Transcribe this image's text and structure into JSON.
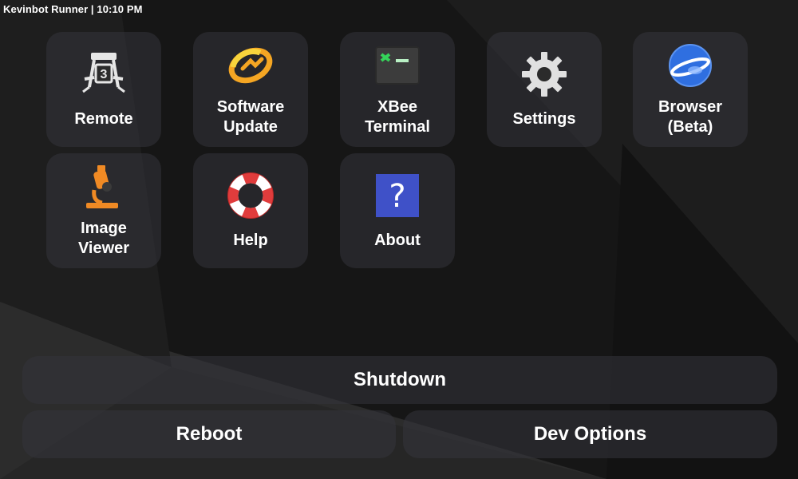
{
  "status_bar": {
    "text": "Kevinbot Runner | 10:10 PM"
  },
  "apps": [
    {
      "label": "Remote",
      "icon": "remote-icon"
    },
    {
      "label": "Software\nUpdate",
      "icon": "software-update-icon"
    },
    {
      "label": "XBee\nTerminal",
      "icon": "terminal-icon"
    },
    {
      "label": "Settings",
      "icon": "gear-icon"
    },
    {
      "label": "Browser\n(Beta)",
      "icon": "browser-icon"
    },
    {
      "label": "Image\nViewer",
      "icon": "microscope-icon"
    },
    {
      "label": "Help",
      "icon": "lifebuoy-icon"
    },
    {
      "label": "About",
      "icon": "question-icon"
    }
  ],
  "actions": {
    "shutdown": "Shutdown",
    "reboot": "Reboot",
    "dev_options": "Dev Options"
  },
  "colors": {
    "background": "#161616",
    "tile": "#34343c",
    "update_orange": "#f5a623",
    "update_yellow": "#f8d43c",
    "terminal_green": "#35d45a",
    "browser_blue": "#2f6fe0",
    "help_red": "#e03c3c",
    "about_blue": "#3f51c8"
  }
}
